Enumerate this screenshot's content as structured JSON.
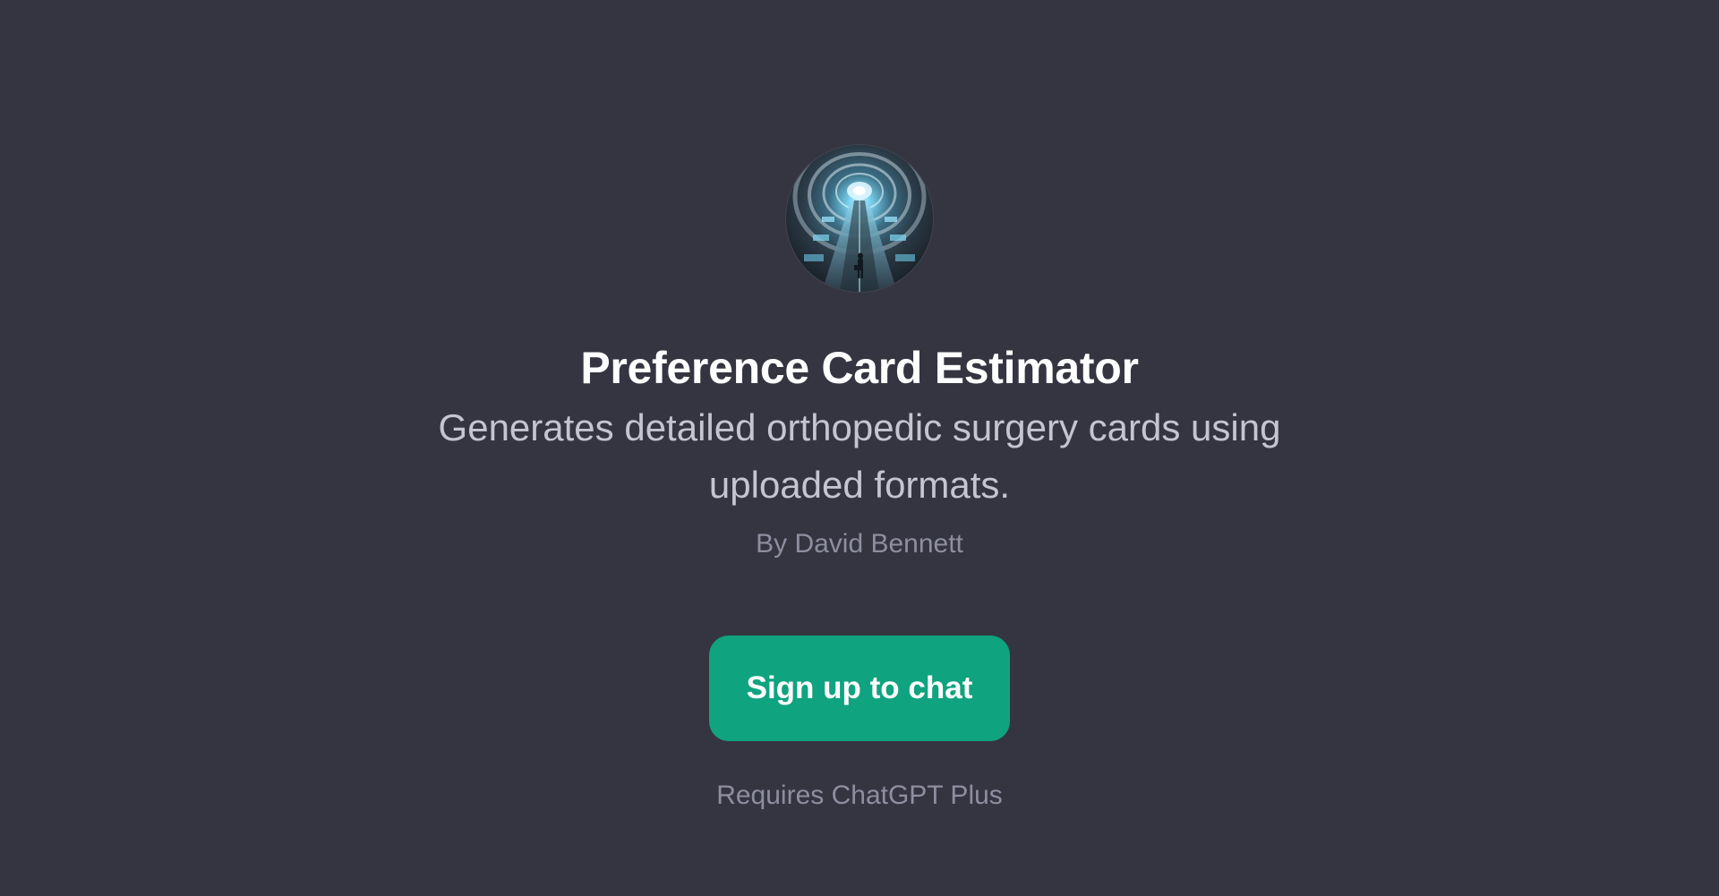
{
  "gpt": {
    "avatar_icon": "tunnel-avatar-icon",
    "title": "Preference Card Estimator",
    "description": "Generates detailed orthopedic surgery cards using uploaded formats.",
    "author": "By David Bennett"
  },
  "cta": {
    "signup_label": "Sign up to chat",
    "requirement": "Requires ChatGPT Plus"
  },
  "colors": {
    "background": "#343541",
    "accent": "#10a37f",
    "title": "#ffffff",
    "description": "#c5c5d2",
    "muted": "#8e8ea0"
  }
}
